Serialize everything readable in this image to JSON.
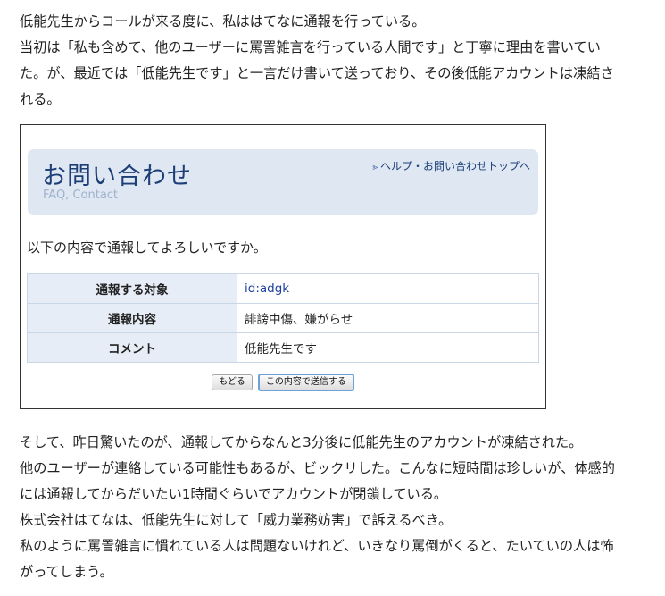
{
  "article": {
    "intro_lines": [
      "低能先生からコールが来る度に、私ははてなに通報を行っている。",
      "当初は「私も含めて、他のユーザーに罵詈雑言を行っている人間です」と丁寧に理由を書いてい",
      "た。が、最近では「低能先生です」と一言だけ書いて送っており、その後低能アカウントは凍結さ",
      "れる。"
    ],
    "outro_lines": [
      "そして、昨日驚いたのが、通報してからなんと3分後に低能先生のアカウントが凍結された。",
      "他のユーザーが連絡している可能性もあるが、ビックリした。こんなに短時間は珍しいが、体感的",
      "には通報してからだいたい1時間ぐらいでアカウントが閉鎖している。",
      "株式会社はてなは、低能先生に対して「威力業務妨害」で訴えるべき。",
      "私のように罵詈雑言に慣れている人は問題ないけれど、いきなり罵倒がくると、たいていの人は怖",
      "がってしまう。"
    ]
  },
  "screenshot": {
    "title": "お問い合わせ",
    "subtitle": "FAQ, Contact",
    "help_link": "ヘルプ・お問い合わせトップへ",
    "help_icon": "chevron-right-icon",
    "confirm_text": "以下の内容で通報してよろしいですか。",
    "rows": [
      {
        "label": "通報する対象",
        "value": "id:adgk"
      },
      {
        "label": "通報内容",
        "value": "誹謗中傷、嫌がらせ"
      },
      {
        "label": "コメント",
        "value": "低能先生です"
      }
    ],
    "back_button": "もどる",
    "submit_button": "この内容で送信する"
  },
  "colors": {
    "header_bg": "#dfe7f2",
    "title": "#1d3f78",
    "table_label_bg": "#e6edf6",
    "table_border": "#c9d6e6",
    "link": "#1d3f9c",
    "primary_button_border": "#6fa0d8"
  }
}
